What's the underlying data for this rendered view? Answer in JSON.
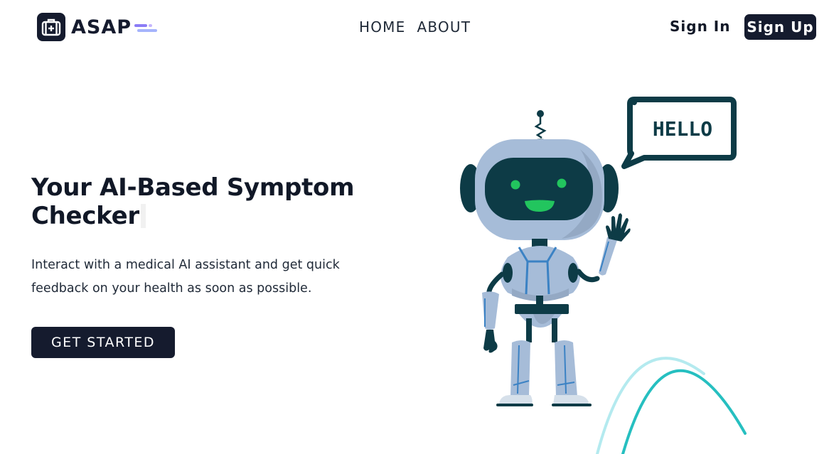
{
  "brand": {
    "name": "ASAP"
  },
  "nav": {
    "items": [
      "HOME",
      "ABOUT"
    ]
  },
  "auth": {
    "signin_label": "Sign In",
    "signup_label": "Sign Up"
  },
  "hero": {
    "title": "Your AI-Based Symptom Checker",
    "subtitle": "Interact with a medical AI assistant and get quick feedback on your health as soon as possible.",
    "cta_label": "GET STARTED"
  },
  "illustration": {
    "speech_bubble_text": "HELLO"
  },
  "icons": {
    "logo": "medical-kit-icon",
    "robot": "robot-illustration",
    "decoration": "arc-lines"
  },
  "colors": {
    "primary": "#151b2e",
    "robot_body": "#a6bcd8",
    "robot_dark": "#0d3b46",
    "robot_face": "#22c55e",
    "accent_teal": "#26bfc0",
    "accent_light": "#b4eaef",
    "logo_dash": "#8b7cf6"
  }
}
